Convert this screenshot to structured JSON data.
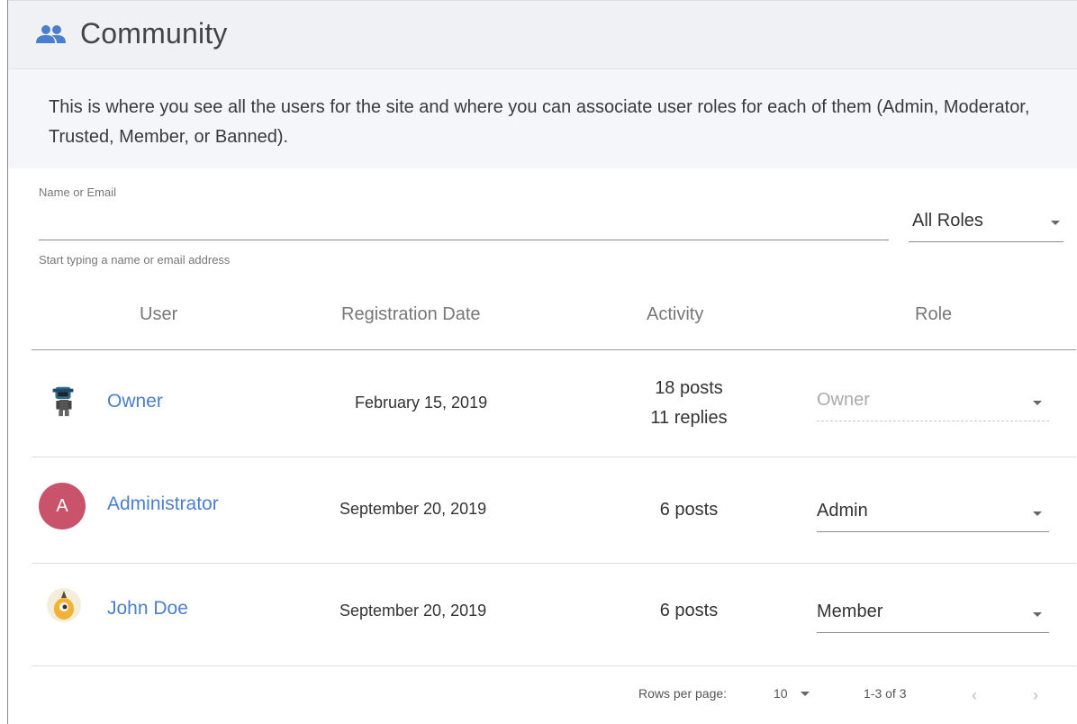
{
  "header": {
    "title": "Community",
    "icon": "people-icon",
    "icon_color": "#4a7fcf"
  },
  "intro": {
    "text": "This is where you see all the users for the site and where you can associate user roles for each of them (Admin, Moderator, Trusted, Member, or Banned)."
  },
  "search": {
    "label": "Name or Email",
    "value": "",
    "helper": "Start typing a name or email address"
  },
  "role_filter": {
    "selected": "All Roles"
  },
  "table": {
    "columns": [
      "User",
      "Registration Date",
      "Activity",
      "Role"
    ],
    "rows": [
      {
        "name": "Owner",
        "avatar": "robot-avatar-icon",
        "date": "February 15, 2019",
        "activity_line1": "18 posts",
        "activity_line2": "11 replies",
        "role": "Owner",
        "role_disabled": true
      },
      {
        "name": "Administrator",
        "avatar_letter": "A",
        "avatar_color": "#c8536a",
        "date": "September 20, 2019",
        "activity_line1": "6 posts",
        "role": "Admin",
        "role_disabled": false
      },
      {
        "name": "John Doe",
        "avatar": "cyclops-avatar-icon",
        "date": "September 20, 2019",
        "activity_line1": "6 posts",
        "role": "Member",
        "role_disabled": false
      }
    ]
  },
  "footer": {
    "rows_per_page_label": "Rows per page:",
    "rows_per_page_value": "10",
    "range": "1-3 of 3",
    "prev": "‹",
    "next": "›"
  }
}
